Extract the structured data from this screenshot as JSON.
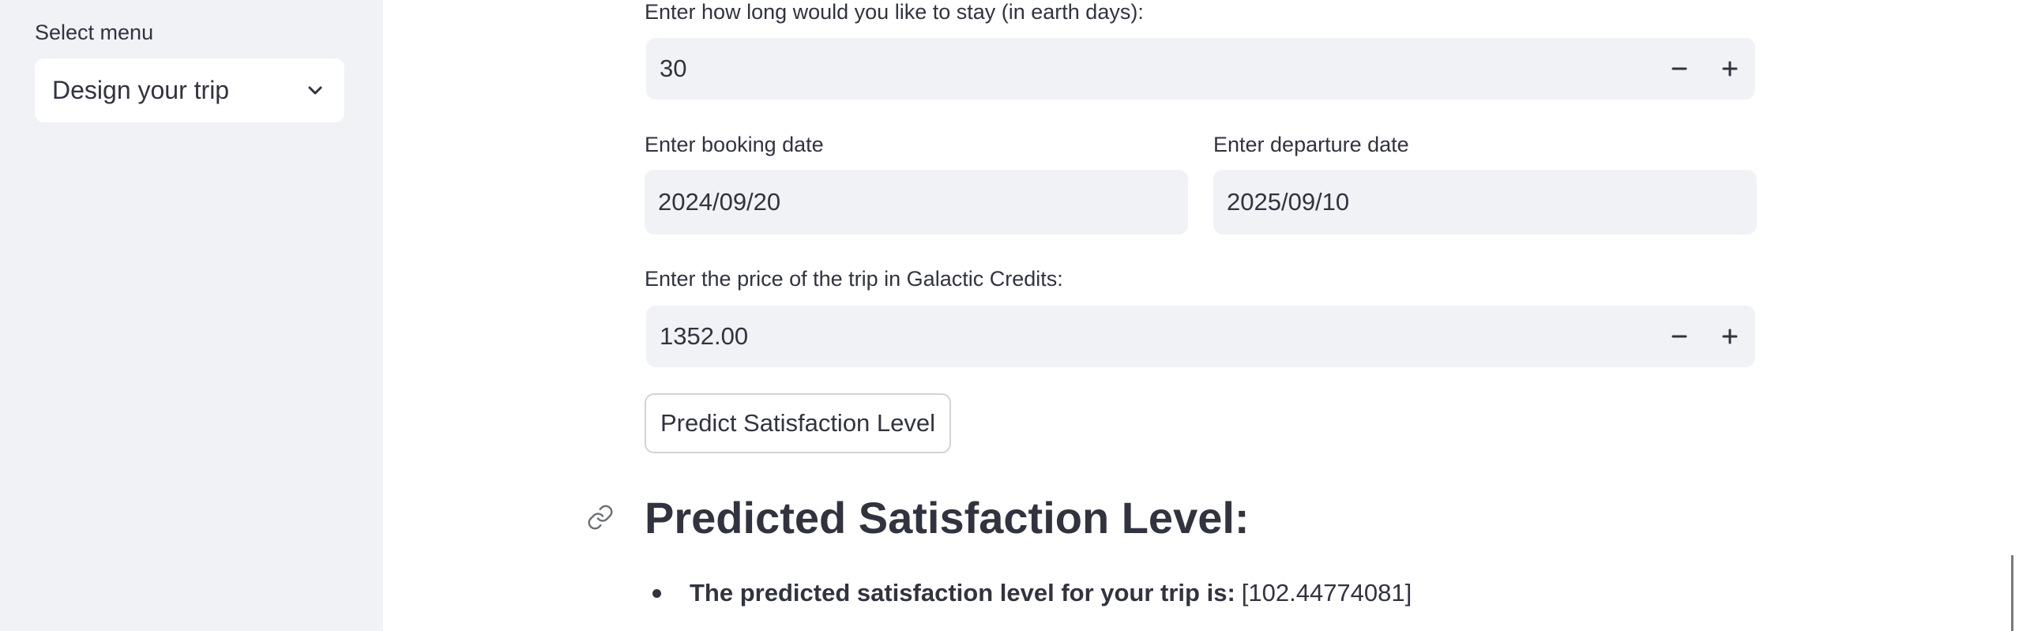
{
  "sidebar": {
    "label": "Select menu",
    "selected": "Design your trip"
  },
  "form": {
    "stay": {
      "label": "Enter how long would you like to stay (in earth days):",
      "value": "30"
    },
    "booking_date": {
      "label": "Enter booking date",
      "value": "2024/09/20"
    },
    "departure_date": {
      "label": "Enter departure date",
      "value": "2025/09/10"
    },
    "price": {
      "label": "Enter the price of the trip in Galactic Credits:",
      "value": "1352.00"
    },
    "submit_label": "Predict Satisfaction Level"
  },
  "result": {
    "heading": "Predicted Satisfaction Level:",
    "line_label": "The predicted satisfaction level for your trip is:",
    "line_value": "[102.44774081]"
  }
}
